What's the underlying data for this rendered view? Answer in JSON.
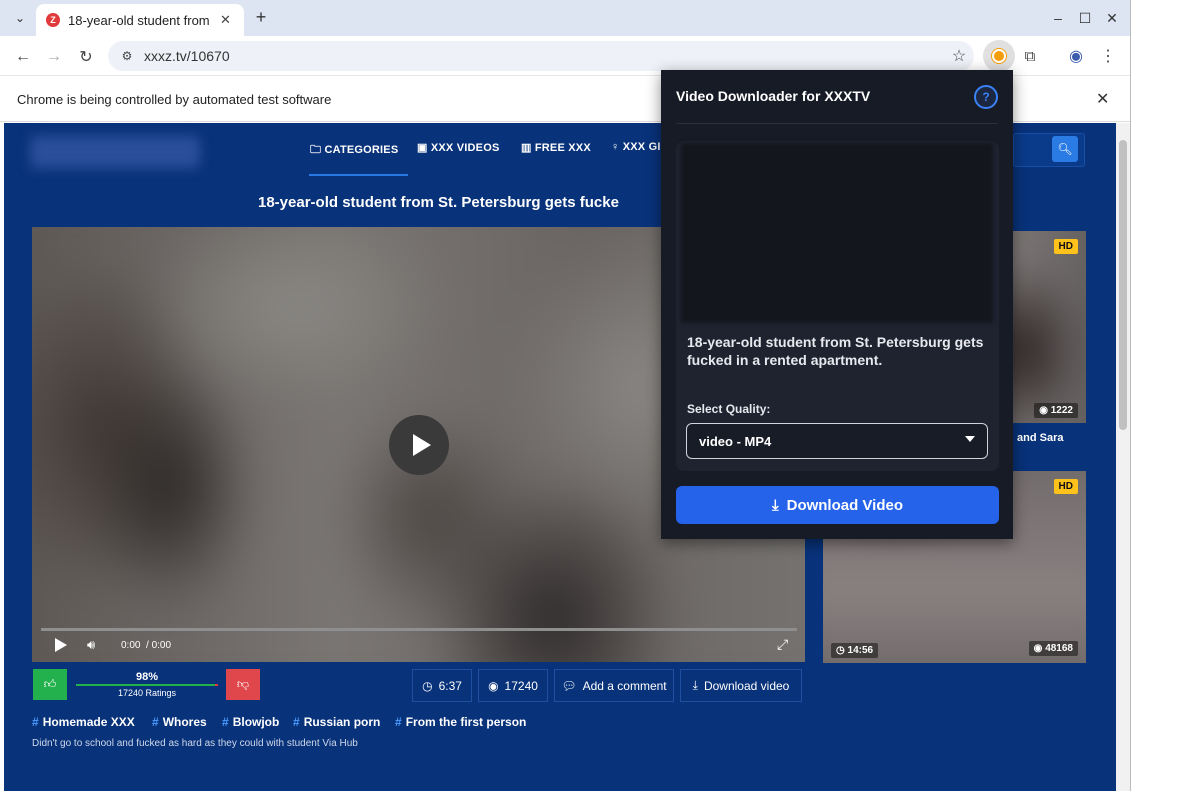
{
  "browser": {
    "tab_title": "18-year-old student from St. Petersburg gets fucked in a rented apartment.",
    "favicon_letter": "Z",
    "url": "xxxz.tv/10670",
    "infobar_text": "Chrome is being controlled by automated test software"
  },
  "site": {
    "nav": [
      {
        "icon": "folder-icon",
        "label": "CATEGORIES"
      },
      {
        "icon": "calendar-icon",
        "label": "XXX VIDEOS"
      },
      {
        "icon": "bar-chart-icon",
        "label": "FREE XXX"
      },
      {
        "icon": "female-icon",
        "label": "XXX GI"
      }
    ],
    "video_title": "18-year-old student from St. Petersburg gets fucke",
    "player": {
      "time": "0:00",
      "duration": "/ 0:00",
      "progress": 0
    },
    "rating": {
      "percent": "98%",
      "count": "17240 Ratings",
      "fraction": 0.98
    },
    "duration": "6:37",
    "views": "17240",
    "comment_label": "Add a comment",
    "download_label": "Download video",
    "tags": [
      "Homemade XXX",
      "Whores",
      "Blowjob",
      "Russian porn",
      "From the first person"
    ],
    "description": "Didn't go to school and fucked as hard as they could with student Via Hub"
  },
  "sidebar": {
    "thumbs": [
      {
        "badge": "HD",
        "views": "1222",
        "caption_fragment": "and Sara"
      },
      {
        "badge": "HD",
        "duration": "14:56",
        "views": "48168"
      }
    ]
  },
  "popup": {
    "title": "Video Downloader for XXXTV",
    "help_label": "?",
    "video_title": "18-year-old student from St. Petersburg gets fucked in a rented apartment.",
    "quality_label": "Select Quality:",
    "quality_value": "video - MP4",
    "download_button": "Download Video"
  },
  "colors": {
    "page_bg": "#08327a",
    "accent": "#2563eb",
    "like": "#22b14c",
    "dislike": "#e0474c",
    "hd_badge": "#ffc21a"
  }
}
